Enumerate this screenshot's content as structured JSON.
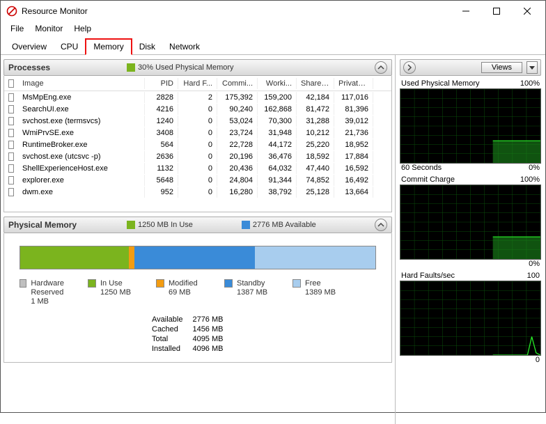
{
  "window": {
    "title": "Resource Monitor"
  },
  "menu": {
    "file": "File",
    "monitor": "Monitor",
    "help": "Help"
  },
  "tabs": {
    "overview": "Overview",
    "cpu": "CPU",
    "memory": "Memory",
    "disk": "Disk",
    "network": "Network"
  },
  "processes": {
    "title": "Processes",
    "legend_text": "30% Used Physical Memory",
    "columns": {
      "image": "Image",
      "pid": "PID",
      "hf": "Hard F...",
      "commit": "Commi...",
      "work": "Worki...",
      "share": "Sharea...",
      "priv": "Private ..."
    },
    "rows": [
      {
        "image": "MsMpEng.exe",
        "pid": "2828",
        "hf": "2",
        "commit": "175,392",
        "work": "159,200",
        "share": "42,184",
        "priv": "117,016"
      },
      {
        "image": "SearchUI.exe",
        "pid": "4216",
        "hf": "0",
        "commit": "90,240",
        "work": "162,868",
        "share": "81,472",
        "priv": "81,396"
      },
      {
        "image": "svchost.exe (termsvcs)",
        "pid": "1240",
        "hf": "0",
        "commit": "53,024",
        "work": "70,300",
        "share": "31,288",
        "priv": "39,012"
      },
      {
        "image": "WmiPrvSE.exe",
        "pid": "3408",
        "hf": "0",
        "commit": "23,724",
        "work": "31,948",
        "share": "10,212",
        "priv": "21,736"
      },
      {
        "image": "RuntimeBroker.exe",
        "pid": "564",
        "hf": "0",
        "commit": "22,728",
        "work": "44,172",
        "share": "25,220",
        "priv": "18,952"
      },
      {
        "image": "svchost.exe (utcsvc -p)",
        "pid": "2636",
        "hf": "0",
        "commit": "20,196",
        "work": "36,476",
        "share": "18,592",
        "priv": "17,884"
      },
      {
        "image": "ShellExperienceHost.exe",
        "pid": "1132",
        "hf": "0",
        "commit": "20,436",
        "work": "64,032",
        "share": "47,440",
        "priv": "16,592"
      },
      {
        "image": "explorer.exe",
        "pid": "5648",
        "hf": "0",
        "commit": "24,804",
        "work": "91,344",
        "share": "74,852",
        "priv": "16,492"
      },
      {
        "image": "dwm.exe",
        "pid": "952",
        "hf": "0",
        "commit": "16,280",
        "work": "38,792",
        "share": "25,128",
        "priv": "13,664"
      }
    ]
  },
  "physmem": {
    "title": "Physical Memory",
    "inuse_legend": "1250 MB In Use",
    "avail_legend": "2776 MB Available",
    "legend": {
      "hw": "Hardware Reserved",
      "hw_v": "1 MB",
      "inuse": "In Use",
      "inuse_v": "1250 MB",
      "mod": "Modified",
      "mod_v": "69 MB",
      "standby": "Standby",
      "standby_v": "1387 MB",
      "free": "Free",
      "free_v": "1389 MB"
    },
    "summary": {
      "available_l": "Available",
      "available_v": "2776 MB",
      "cached_l": "Cached",
      "cached_v": "1456 MB",
      "total_l": "Total",
      "total_v": "4095 MB",
      "installed_l": "Installed",
      "installed_v": "4096 MB"
    }
  },
  "right": {
    "views": "Views",
    "g1_title": "Used Physical Memory",
    "g1_max": "100%",
    "g1_bl": "60 Seconds",
    "g1_br": "0%",
    "g2_title": "Commit Charge",
    "g2_max": "100%",
    "g2_br": "0%",
    "g3_title": "Hard Faults/sec",
    "g3_max": "100",
    "g3_br": "0"
  },
  "chart_data": [
    {
      "type": "area",
      "title": "Used Physical Memory",
      "ylabel": "%",
      "ylim": [
        0,
        100
      ],
      "xlabel": "Seconds",
      "xlim": [
        60,
        0
      ],
      "series": [
        {
          "name": "used",
          "values": [
            30,
            30,
            30,
            30,
            30,
            30,
            30,
            30,
            30,
            30,
            30,
            30
          ]
        }
      ]
    },
    {
      "type": "area",
      "title": "Commit Charge",
      "ylabel": "%",
      "ylim": [
        0,
        100
      ],
      "xlabel": "Seconds",
      "xlim": [
        60,
        0
      ],
      "series": [
        {
          "name": "commit",
          "values": [
            30,
            30,
            30,
            30,
            30,
            30,
            30,
            30,
            30,
            30,
            30,
            30
          ]
        }
      ]
    },
    {
      "type": "line",
      "title": "Hard Faults/sec",
      "ylabel": "",
      "ylim": [
        0,
        100
      ],
      "xlabel": "Seconds",
      "xlim": [
        60,
        0
      ],
      "series": [
        {
          "name": "faults",
          "values": [
            0,
            0,
            0,
            0,
            0,
            0,
            0,
            0,
            0,
            25,
            3,
            0
          ]
        }
      ]
    }
  ],
  "colors": {
    "green": "#7bb41e",
    "orange": "#f39c12",
    "blue": "#3a8bd8",
    "lightblue": "#a8cdee",
    "grey": "#bfbfbf",
    "graph_line": "#28f028",
    "graph_fill": "#1a8a1a"
  }
}
